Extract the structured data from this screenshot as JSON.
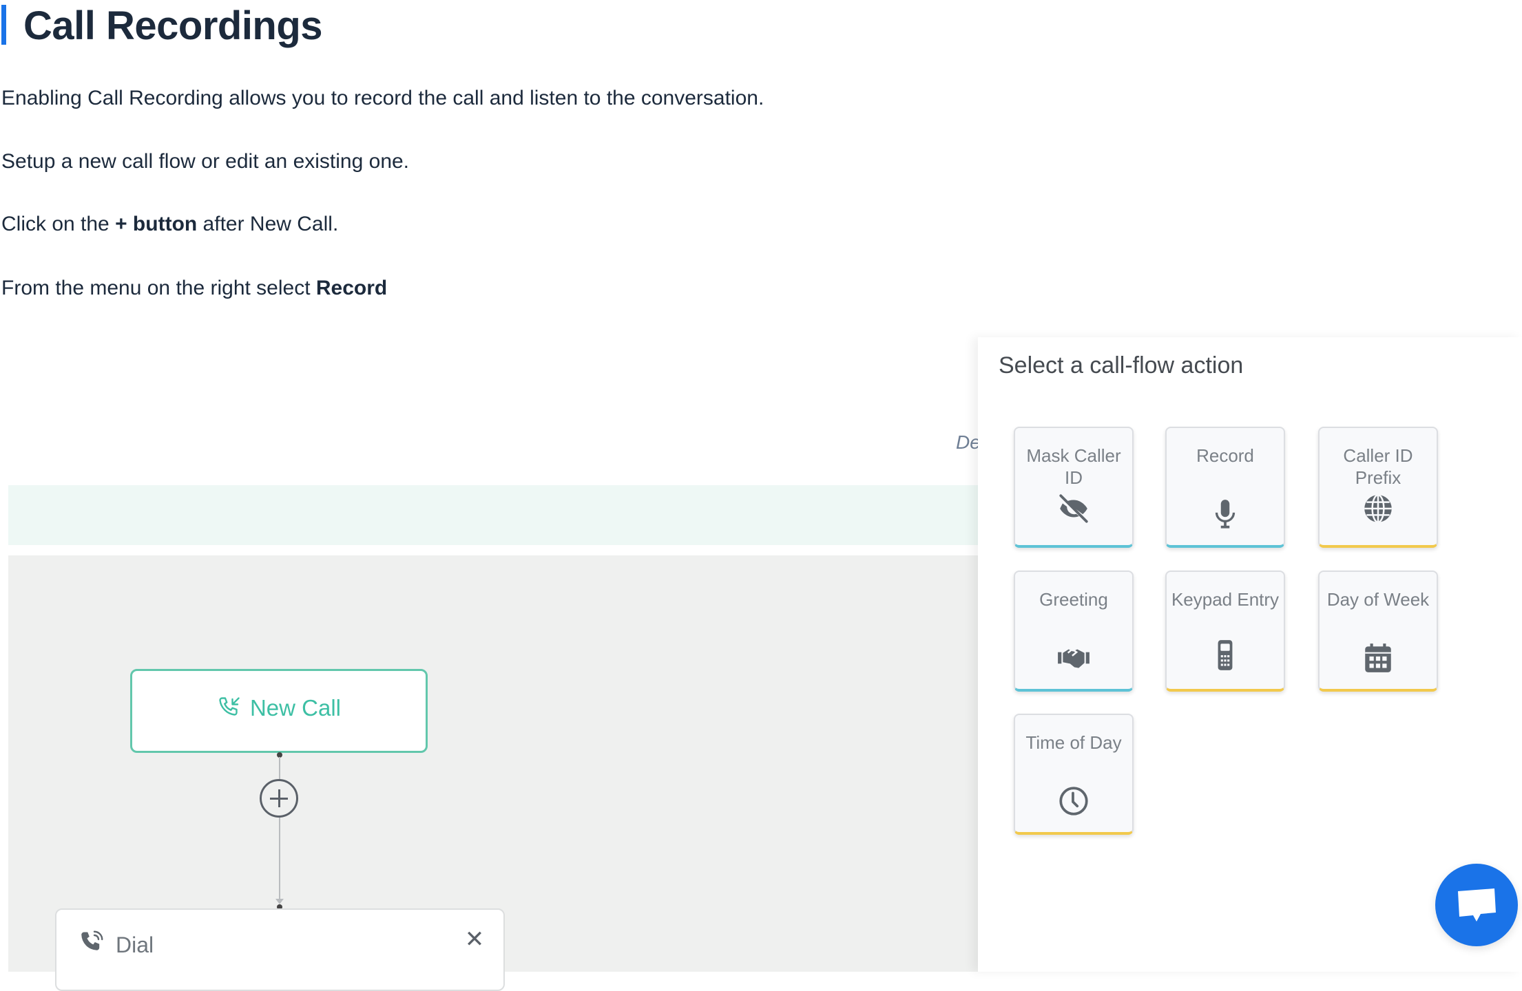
{
  "article": {
    "title": "Call Recordings",
    "accent_color": "#1a73e8",
    "paragraphs": {
      "p1": "Enabling Call Recording allows you to record the call and listen to the conversation.",
      "p2": "Setup a new call flow or edit an existing one.",
      "p3": {
        "before": "Click on the ",
        "bold": "+ button",
        "after": " after New Call."
      },
      "p4": {
        "before": "From the menu on the right select ",
        "bold": "Record"
      }
    }
  },
  "flow_editor": {
    "truncated_label": "De",
    "nodes": {
      "new_call": {
        "label": "New Call",
        "icon": "phone-incoming-icon",
        "color": "#3dbfa4"
      },
      "add_step": {
        "icon": "plus-icon"
      },
      "dial": {
        "label": "Dial",
        "icon": "phone-ringing-icon",
        "close_label": "✕"
      }
    }
  },
  "action_panel": {
    "title": "Select a call-flow action",
    "actions": [
      {
        "label": "Mask Caller ID",
        "icon": "eye-slash-icon",
        "accent": "teal"
      },
      {
        "label": "Record",
        "icon": "microphone-icon",
        "accent": "teal"
      },
      {
        "label": "Caller ID Prefix",
        "icon": "globe-icon",
        "accent": "yellow"
      },
      {
        "label": "Greeting",
        "icon": "handshake-icon",
        "accent": "teal"
      },
      {
        "label": "Keypad Entry",
        "icon": "mobile-keypad-icon",
        "accent": "yellow"
      },
      {
        "label": "Day of Week",
        "icon": "calendar-icon",
        "accent": "yellow"
      },
      {
        "label": "Time of Day",
        "icon": "clock-icon",
        "accent": "yellow"
      }
    ],
    "accent_colors": {
      "teal": "#5ec3d6",
      "yellow": "#f2c94c"
    }
  },
  "chat_widget": {
    "icon": "chat-bubble-icon",
    "color": "#1a73e8"
  }
}
